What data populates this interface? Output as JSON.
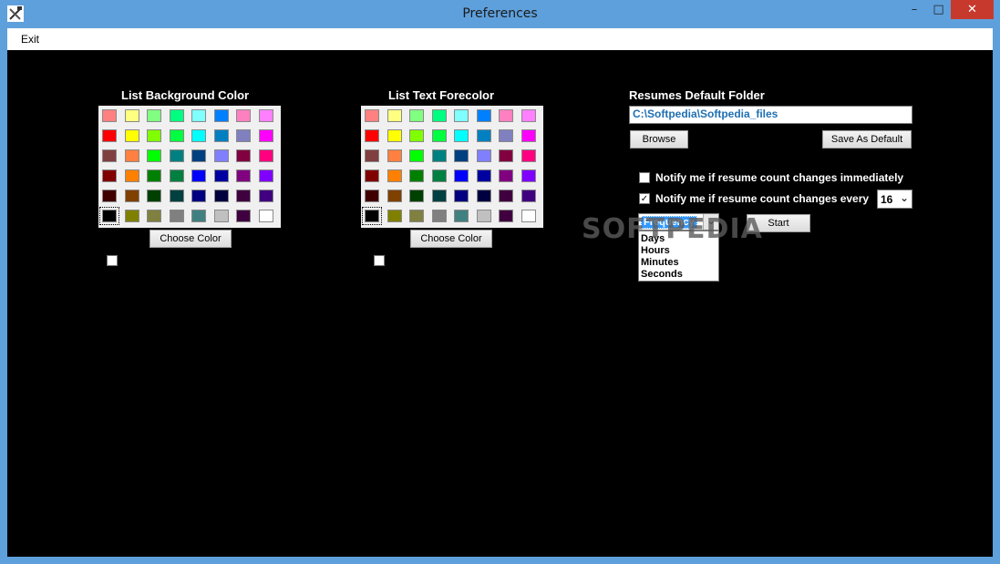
{
  "window": {
    "title": "Preferences",
    "min_glyph": "–",
    "max_glyph": "□",
    "close_glyph": "✕"
  },
  "menu": {
    "exit": "Exit"
  },
  "palette_colors": [
    [
      "#ff8080",
      "#ffff80",
      "#80ff80",
      "#00ff80",
      "#80ffff",
      "#0080ff",
      "#ff80c0",
      "#ff80ff"
    ],
    [
      "#ff0000",
      "#ffff00",
      "#80ff00",
      "#00ff40",
      "#00ffff",
      "#0080c0",
      "#8080c0",
      "#ff00ff"
    ],
    [
      "#804040",
      "#ff8040",
      "#00ff00",
      "#008080",
      "#004080",
      "#8080ff",
      "#800040",
      "#ff0080"
    ],
    [
      "#800000",
      "#ff8000",
      "#008000",
      "#008040",
      "#0000ff",
      "#0000a0",
      "#800080",
      "#8000ff"
    ],
    [
      "#400000",
      "#804000",
      "#004000",
      "#004040",
      "#000080",
      "#000040",
      "#400040",
      "#400080"
    ],
    [
      "#000000",
      "#808000",
      "#808040",
      "#808080",
      "#408080",
      "#c0c0c0",
      "#400040",
      "#ffffff"
    ]
  ],
  "background_section": {
    "title": "List Background Color",
    "choose_button": "Choose Color"
  },
  "forecolor_section": {
    "title": "List Text Forecolor",
    "choose_button": "Choose Color"
  },
  "folder_section": {
    "title": "Resumes Default Folder",
    "path": "C:\\Softpedia\\Softpedia_files",
    "browse_button": "Browse",
    "save_default_button": "Save As Default"
  },
  "notify": {
    "immediately_label": "Notify me if resume count changes immediately",
    "immediately_checked": false,
    "every_label": "Notify me if resume count changes every",
    "every_checked": true,
    "every_check_glyph": "✓",
    "interval_value": "16",
    "dropdown_arrow": "⌄",
    "frequency_value": "Frequency",
    "frequency_options": [
      "Days",
      "Hours",
      "Minutes",
      "Seconds"
    ],
    "start_button": "Start"
  },
  "watermark": "SOFTPEDIA"
}
